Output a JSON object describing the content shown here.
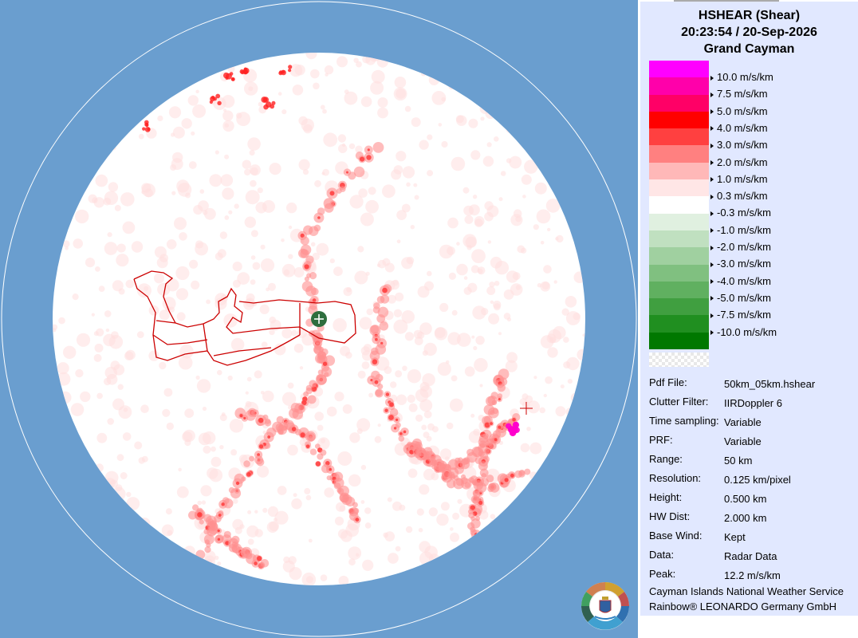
{
  "header": {
    "product": "HSHEAR (Shear)",
    "datetime": "20:23:54 / 20-Sep-2026",
    "site": "Grand Cayman"
  },
  "legend": [
    {
      "label": "10.0 m/s/km",
      "color": "#ff00ff"
    },
    {
      "label": "7.5 m/s/km",
      "color": "#ff00aa"
    },
    {
      "label": "5.0 m/s/km",
      "color": "#ff0066"
    },
    {
      "label": "4.0 m/s/km",
      "color": "#ff0000"
    },
    {
      "label": "3.0 m/s/km",
      "color": "#ff4040"
    },
    {
      "label": "2.0 m/s/km",
      "color": "#ff8080"
    },
    {
      "label": "1.0 m/s/km",
      "color": "#ffb8b8"
    },
    {
      "label": "0.3 m/s/km",
      "color": "#ffe6e6"
    },
    {
      "label": "-0.3 m/s/km",
      "color": "#ffffff"
    },
    {
      "label": "-1.0 m/s/km",
      "color": "#e0f0e0"
    },
    {
      "label": "-2.0 m/s/km",
      "color": "#c0e0c0"
    },
    {
      "label": "-3.0 m/s/km",
      "color": "#a0d0a0"
    },
    {
      "label": "-4.0 m/s/km",
      "color": "#80c080"
    },
    {
      "label": "-5.0 m/s/km",
      "color": "#60b060"
    },
    {
      "label": "-7.5 m/s/km",
      "color": "#409f40"
    },
    {
      "label": "-10.0 m/s/km",
      "color": "#208f20"
    },
    {
      "label": "",
      "color": "#007800"
    }
  ],
  "info": [
    {
      "key": "Pdf File:",
      "value": "50km_05km.hshear"
    },
    {
      "key": "Clutter Filter:",
      "value": "IIRDoppler 6"
    },
    {
      "key": "Time sampling:",
      "value": "Variable"
    },
    {
      "key": "PRF:",
      "value": "Variable"
    },
    {
      "key": "Range:",
      "value": "50 km"
    },
    {
      "key": "Resolution:",
      "value": "0.125 km/pixel"
    },
    {
      "key": "Height:",
      "value": "0.500 km"
    },
    {
      "key": "HW Dist:",
      "value": "2.000 km"
    },
    {
      "key": "Base Wind:",
      "value": "Kept"
    },
    {
      "key": "Data:",
      "value": "Radar Data"
    },
    {
      "key": "Peak:",
      "value": "12.2 m/s/km"
    }
  ],
  "footer": {
    "org": "Cayman Islands National Weather Service",
    "vendor": "Rainbow® LEONARDO Germany GmbH"
  },
  "colors": {
    "background": "#6a9ecf",
    "panel": "#e1e8ff",
    "coastline": "#cc0000",
    "radar_site": "#2e6e3e"
  }
}
